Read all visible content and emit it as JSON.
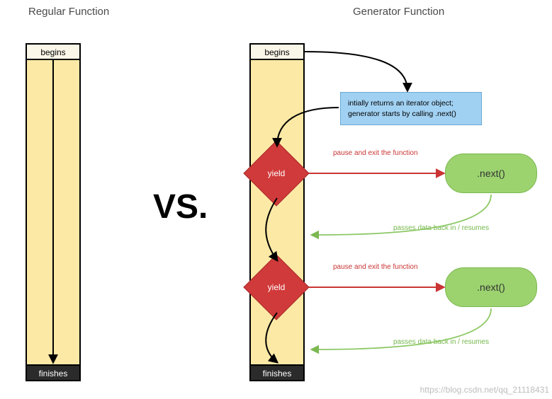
{
  "titles": {
    "left": "Regular Function",
    "right": "Generator Function"
  },
  "vs": "VS.",
  "labels": {
    "begins": "begins",
    "finishes": "finishes",
    "yield": "yield",
    "next": ".next()"
  },
  "infobox": "intially returns an iterator object; generator starts by calling .next()",
  "captions": {
    "pause": "pause and exit the function",
    "resume": "passes data back in / resumes"
  },
  "watermark": "https://blog.csdn.net/qq_21118431",
  "colors": {
    "bar_fill": "#fce9a5",
    "yield_fill": "#d13a3a",
    "next_fill": "#9cd36f",
    "info_fill": "#a1d1f2",
    "red_text": "#cb3434",
    "green_text": "#75b84b"
  }
}
